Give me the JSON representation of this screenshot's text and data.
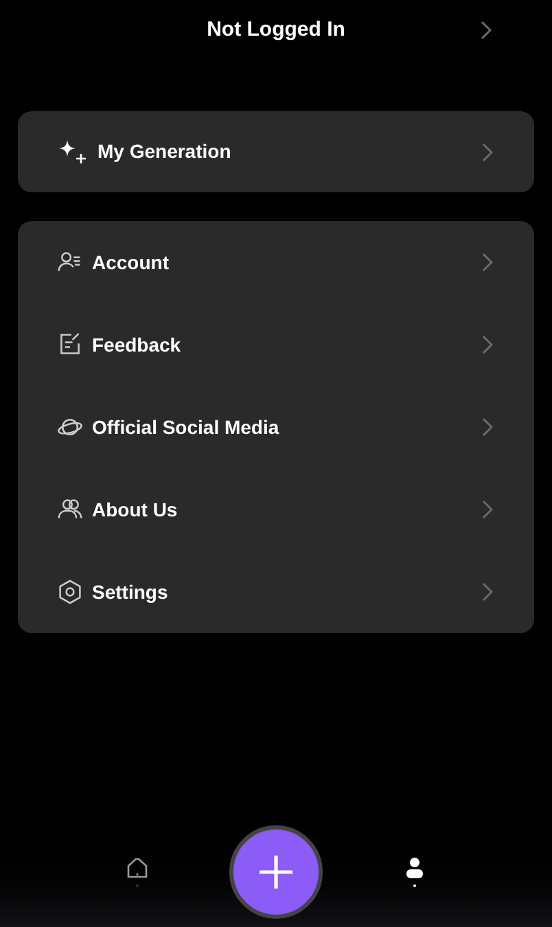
{
  "header": {
    "title": "Not Logged In"
  },
  "generation": {
    "label": "My Generation"
  },
  "menu": [
    {
      "label": "Account"
    },
    {
      "label": "Feedback"
    },
    {
      "label": "Official Social Media"
    },
    {
      "label": "About Us"
    },
    {
      "label": "Settings"
    }
  ],
  "tab_bar": {
    "tabs": [
      {
        "kind": "home",
        "selected": false
      },
      {
        "kind": "create",
        "selected": false
      },
      {
        "kind": "profile",
        "selected": true
      }
    ]
  }
}
